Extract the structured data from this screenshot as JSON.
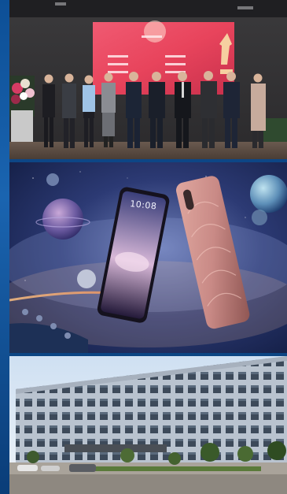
{
  "photos": [
    {
      "subject": "ceremony-group-photo"
    },
    {
      "subject": "smartphone-product-render",
      "phone_clock": "10:08"
    },
    {
      "subject": "office-building-exterior"
    }
  ],
  "colors": {
    "page_background": "#0b3f7a",
    "stage_screen": "#e8445c",
    "phone_body": "#c98a86",
    "building_facade": "#b9c3cf"
  }
}
